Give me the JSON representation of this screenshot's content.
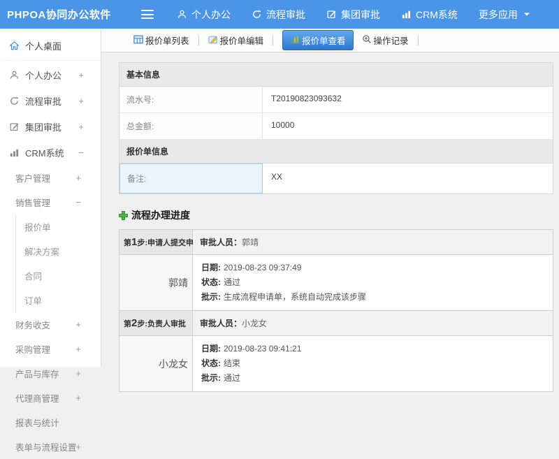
{
  "colors": {
    "navbar_blue": "#4b95e8",
    "active_tab_top": "#63a8ef",
    "active_tab_bottom": "#2f78cf",
    "highlight_cell": "#e9f4fc",
    "plus_green": "#52b54b"
  },
  "navbar": {
    "brand": "PHPOA协同办公软件",
    "items": [
      {
        "label": "个人办公",
        "icon": "user-icon"
      },
      {
        "label": "流程审批",
        "icon": "cycle-icon"
      },
      {
        "label": "集团审批",
        "icon": "edit-square-icon"
      },
      {
        "label": "CRM系统",
        "icon": "bar-chart-icon"
      },
      {
        "label": "更多应用",
        "icon": "caret-down-icon"
      }
    ]
  },
  "sidebar": {
    "items": [
      {
        "label": "个人桌面",
        "icon": "home-icon",
        "toggle": ""
      },
      {
        "label": "个人办公",
        "icon": "user-icon",
        "toggle": "+"
      },
      {
        "label": "流程审批",
        "icon": "cycle-icon",
        "toggle": "+"
      },
      {
        "label": "集团审批",
        "icon": "edit-square-icon",
        "toggle": "+"
      },
      {
        "label": "CRM系统",
        "icon": "bar-chart-icon",
        "toggle": "−"
      },
      {
        "label": "客户管理",
        "toggle": "+"
      },
      {
        "label": "销售管理",
        "toggle": "−"
      },
      {
        "label": "报价单",
        "toggle": ""
      },
      {
        "label": "解决方案",
        "toggle": ""
      },
      {
        "label": "合同",
        "toggle": ""
      },
      {
        "label": "订单",
        "toggle": ""
      },
      {
        "label": "财务收支",
        "toggle": "+"
      },
      {
        "label": "采购管理",
        "toggle": "+"
      },
      {
        "label": "产品与库存",
        "toggle": "+"
      },
      {
        "label": "代理商管理",
        "toggle": "+"
      },
      {
        "label": "报表与统计",
        "toggle": ""
      },
      {
        "label": "表单与流程设置",
        "toggle": "+"
      }
    ]
  },
  "tabs": [
    {
      "label": "报价单列表",
      "icon": "table-icon",
      "active": false
    },
    {
      "label": "报价单编辑",
      "icon": "edit-note-icon",
      "active": false
    },
    {
      "label": "报价单查看",
      "icon": "view-chart-icon",
      "active": true
    },
    {
      "label": "操作记录",
      "icon": "magnifier-plus-icon",
      "active": false
    }
  ],
  "form": {
    "sections": [
      {
        "header": "基本信息",
        "rows": [
          {
            "label": "流水号:",
            "value": "T20190823093632"
          },
          {
            "label": "总金额:",
            "value": "10000"
          }
        ]
      },
      {
        "header": "报价单信息",
        "rows": [
          {
            "label": "备注:",
            "value": "XX"
          }
        ]
      }
    ]
  },
  "process": {
    "title": "流程办理进度",
    "labels": {
      "approver": "审批人员：",
      "date": "日期:",
      "status": "状态:",
      "comment": "批示:"
    },
    "steps": [
      {
        "prefix": "第",
        "num": "1",
        "suffix": "步:申请人提交申请",
        "approver": "郭靖",
        "name": "郭靖",
        "date": "2019-08-23 09:37:49",
        "status": "通过",
        "comment": "生成流程申请单，系统自动完成该步骤"
      },
      {
        "prefix": "第",
        "num": "2",
        "suffix": "步:负责人审批",
        "approver": "小龙女",
        "name": "小龙女",
        "date": "2019-08-23 09:41:21",
        "status": "结束",
        "comment": "通过"
      }
    ]
  }
}
